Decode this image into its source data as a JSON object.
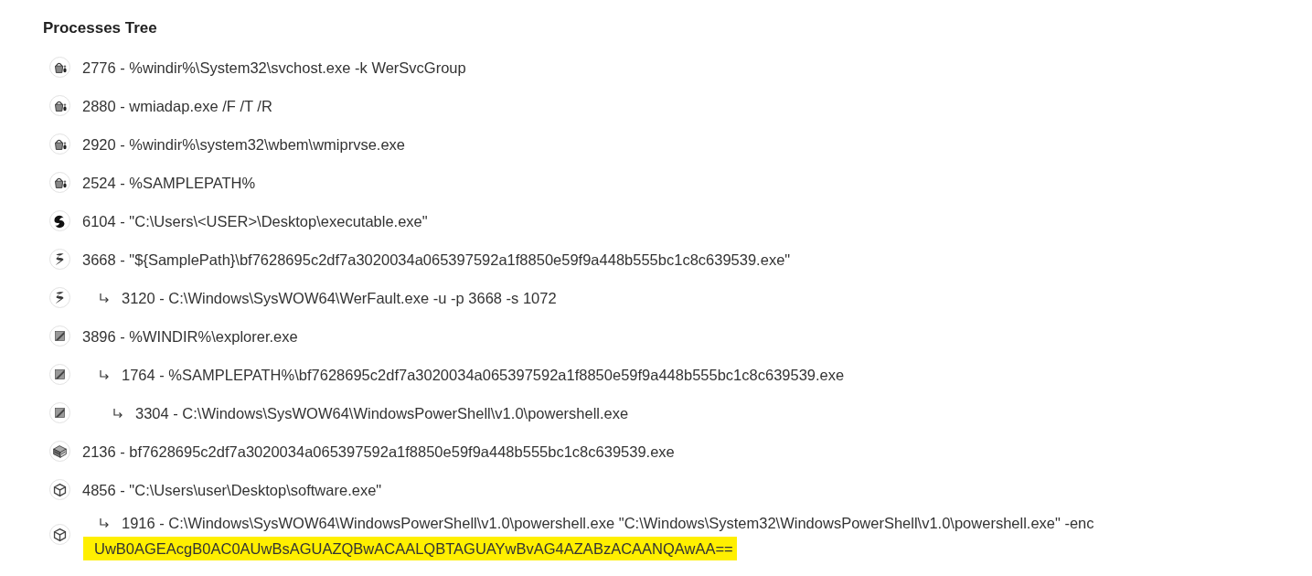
{
  "title": "Processes Tree",
  "processes": [
    {
      "kind": "bucket",
      "text": "2776 - %windir%\\System32\\svchost.exe -k WerSvcGroup"
    },
    {
      "kind": "bucket",
      "text": "2880 - wmiadap.exe /F /T /R"
    },
    {
      "kind": "bucket",
      "text": "2920 - %windir%\\system32\\wbem\\wmiprvse.exe"
    },
    {
      "kind": "bucket",
      "text": "2524 - %SAMPLEPATH%"
    },
    {
      "kind": "swirl",
      "text": "6104 - \"C:\\Users\\<USER>\\Desktop\\executable.exe\""
    },
    {
      "kind": "scythe",
      "text": "3668 - \"${SamplePath}\\bf7628695c2df7a3020034a065397592a1f8850e59f9a448b555bc1c8c639539.exe\"",
      "children": [
        {
          "kind": "scythe",
          "text": "3120 - C:\\Windows\\SysWOW64\\WerFault.exe -u -p 3668 -s 1072"
        }
      ]
    },
    {
      "kind": "square",
      "text": "3896 - %WINDIR%\\explorer.exe",
      "children": [
        {
          "kind": "square",
          "text": "1764 - %SAMPLEPATH%\\bf7628695c2df7a3020034a065397592a1f8850e59f9a448b555bc1c8c639539.exe",
          "children": [
            {
              "kind": "square",
              "text": "3304 - C:\\Windows\\SysWOW64\\WindowsPowerShell\\v1.0\\powershell.exe"
            }
          ]
        }
      ]
    },
    {
      "kind": "crate",
      "text": "2136 - bf7628695c2df7a3020034a065397592a1f8850e59f9a448b555bc1c8c639539.exe"
    },
    {
      "kind": "cube",
      "text": "4856 - \"C:\\Users\\user\\Desktop\\software.exe\"",
      "children": [
        {
          "kind": "cube",
          "text": "1916 - C:\\Windows\\SysWOW64\\WindowsPowerShell\\v1.0\\powershell.exe \"C:\\Windows\\System32\\WindowsPowerShell\\v1.0\\powershell.exe\" -enc",
          "highlighted_text": "UwB0AGEAcgB0AC0AUwBsAGUAZQBwACAALQBTAGUAYwBvAG4AZABzACAANQAwAA=="
        }
      ]
    }
  ]
}
